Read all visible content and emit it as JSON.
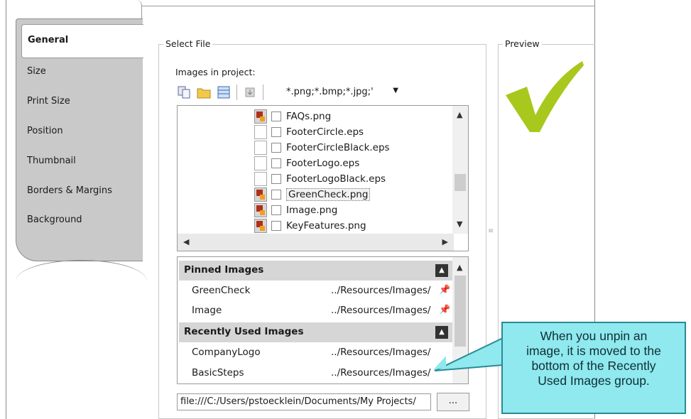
{
  "tabs": [
    {
      "label": "General",
      "active": true
    },
    {
      "label": "Size"
    },
    {
      "label": "Print Size"
    },
    {
      "label": "Position"
    },
    {
      "label": "Thumbnail"
    },
    {
      "label": "Borders & Margins"
    },
    {
      "label": "Background"
    }
  ],
  "select_file": {
    "legend": "Select File",
    "images_label": "Images in project:",
    "filter": "*.png;*.bmp;*.jpg;'",
    "toolbar_icons": [
      "copy-icon",
      "folder-icon",
      "grid-view-icon",
      "import-icon"
    ],
    "files": [
      {
        "name": "FAQs.png",
        "type": "image"
      },
      {
        "name": "FooterCircle.eps",
        "type": "doc"
      },
      {
        "name": "FooterCircleBlack.eps",
        "type": "doc"
      },
      {
        "name": "FooterLogo.eps",
        "type": "doc"
      },
      {
        "name": "FooterLogoBlack.eps",
        "type": "doc"
      },
      {
        "name": "GreenCheck.png",
        "type": "image",
        "selected": true
      },
      {
        "name": "Image.png",
        "type": "image"
      },
      {
        "name": "KeyFeatures.png",
        "type": "image"
      }
    ],
    "pinned_header": "Pinned Images",
    "pinned": [
      {
        "name": "GreenCheck",
        "path": "../Resources/Images/"
      },
      {
        "name": "Image",
        "path": "../Resources/Images/"
      }
    ],
    "recent_header": "Recently Used Images",
    "recent": [
      {
        "name": "CompanyLogo",
        "path": "../Resources/Images/"
      },
      {
        "name": "BasicSteps",
        "path": "../Resources/Images/"
      }
    ],
    "path": "file:///C:/Users/pstoecklein/Documents/My Projects/",
    "browse_label": "..."
  },
  "preview": {
    "legend": "Preview",
    "accent": "#a8c81e"
  },
  "callout": {
    "lines": [
      "When you unpin an",
      "image, it is moved to the",
      "bottom of the Recently",
      "Used Images group."
    ],
    "color": "#8fe9ee"
  }
}
